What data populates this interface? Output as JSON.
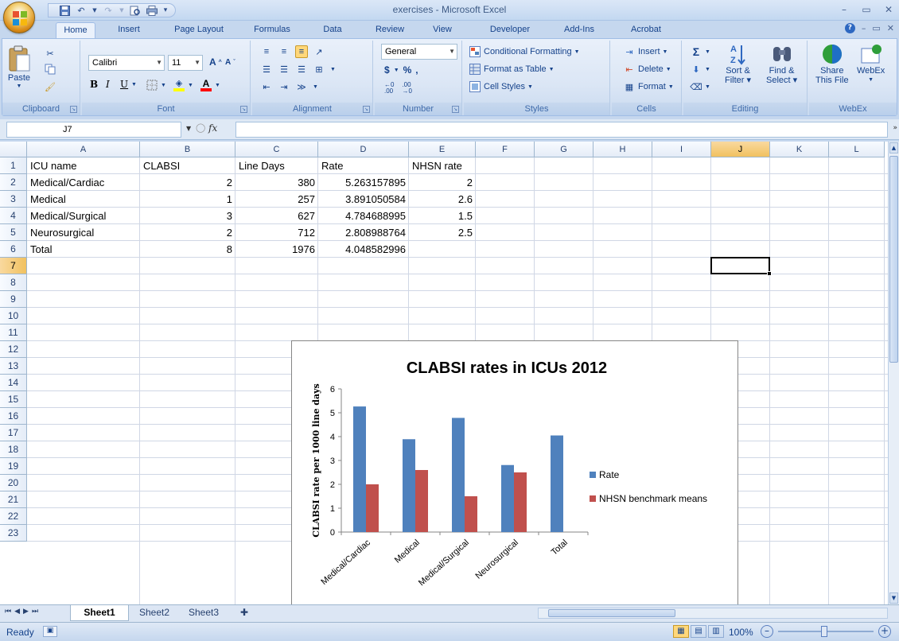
{
  "window": {
    "title": "exercises - Microsoft Excel"
  },
  "tabs": [
    "Home",
    "Insert",
    "Page Layout",
    "Formulas",
    "Data",
    "Review",
    "View",
    "Developer",
    "Add-Ins",
    "Acrobat"
  ],
  "ribbon": {
    "clipboard": {
      "label": "Clipboard",
      "paste": "Paste"
    },
    "font": {
      "label": "Font",
      "name": "Calibri",
      "size": "11",
      "bold": "B",
      "italic": "I",
      "underline": "U"
    },
    "alignment": {
      "label": "Alignment"
    },
    "number": {
      "label": "Number",
      "format": "General",
      "currency": "$",
      "percent": "%",
      "comma": ",",
      "inc_decimal": ".00",
      "dec_decimal": ".00"
    },
    "styles": {
      "label": "Styles",
      "conditional": "Conditional Formatting",
      "format_table": "Format as Table",
      "cell_styles": "Cell Styles"
    },
    "cells": {
      "label": "Cells",
      "insert": "Insert",
      "delete": "Delete",
      "format": "Format"
    },
    "editing": {
      "label": "Editing",
      "sort_1": "Sort &",
      "sort_2": "Filter",
      "find_1": "Find &",
      "find_2": "Select",
      "sigma": "Σ"
    },
    "webex": {
      "label": "WebEx",
      "share_1": "Share",
      "share_2": "This File",
      "webex": "WebEx"
    }
  },
  "formula_bar": {
    "name_box": "J7",
    "fx": "fx",
    "value": ""
  },
  "columns": [
    "A",
    "B",
    "C",
    "D",
    "E",
    "F",
    "G",
    "H",
    "I",
    "J",
    "K",
    "L"
  ],
  "rows": [
    "1",
    "2",
    "3",
    "4",
    "5",
    "6",
    "7",
    "8",
    "9",
    "10",
    "11",
    "12",
    "13",
    "14",
    "15",
    "16",
    "17",
    "18",
    "19",
    "20",
    "21",
    "22",
    "23"
  ],
  "cells": {
    "A1": "ICU name",
    "B1": "CLABSI",
    "C1": "Line Days",
    "D1": "Rate",
    "E1": "NHSN rate",
    "A2": "Medical/Cardiac",
    "B2": "2",
    "C2": "380",
    "D2": "5.263157895",
    "E2": "2",
    "A3": "Medical",
    "B3": "1",
    "C3": "257",
    "D3": "3.891050584",
    "E3": "2.6",
    "A4": "Medical/Surgical",
    "B4": "3",
    "C4": "627",
    "D4": "4.784688995",
    "E4": "1.5",
    "A5": "Neurosurgical",
    "B5": "2",
    "C5": "712",
    "D5": "2.808988764",
    "E5": "2.5",
    "A6": "Total",
    "B6": "8",
    "C6": "1976",
    "D6": "4.048582996"
  },
  "selected_cell": "J7",
  "chart_data": {
    "type": "bar",
    "title": "CLABSI rates in ICUs 2012",
    "xlabel": "",
    "ylabel": "CLABSI rate per 1000 line days",
    "categories": [
      "Medical/Cardiac",
      "Medical",
      "Medical/Surgical",
      "Neurosurgical",
      "Total"
    ],
    "series": [
      {
        "name": "Rate",
        "color": "#4f81bd",
        "values": [
          5.263157895,
          3.891050584,
          4.784688995,
          2.808988764,
          4.048582996
        ]
      },
      {
        "name": "NHSN benchmark means",
        "color": "#c0504d",
        "values": [
          2,
          2.6,
          1.5,
          2.5,
          null
        ]
      }
    ],
    "ylim": [
      0,
      6
    ],
    "yticks": [
      "0",
      "1",
      "2",
      "3",
      "4",
      "5",
      "6"
    ],
    "grid": false,
    "legend": "right"
  },
  "sheets": [
    "Sheet1",
    "Sheet2",
    "Sheet3"
  ],
  "active_sheet": "Sheet1",
  "status": {
    "text": "Ready",
    "zoom": "100%"
  }
}
